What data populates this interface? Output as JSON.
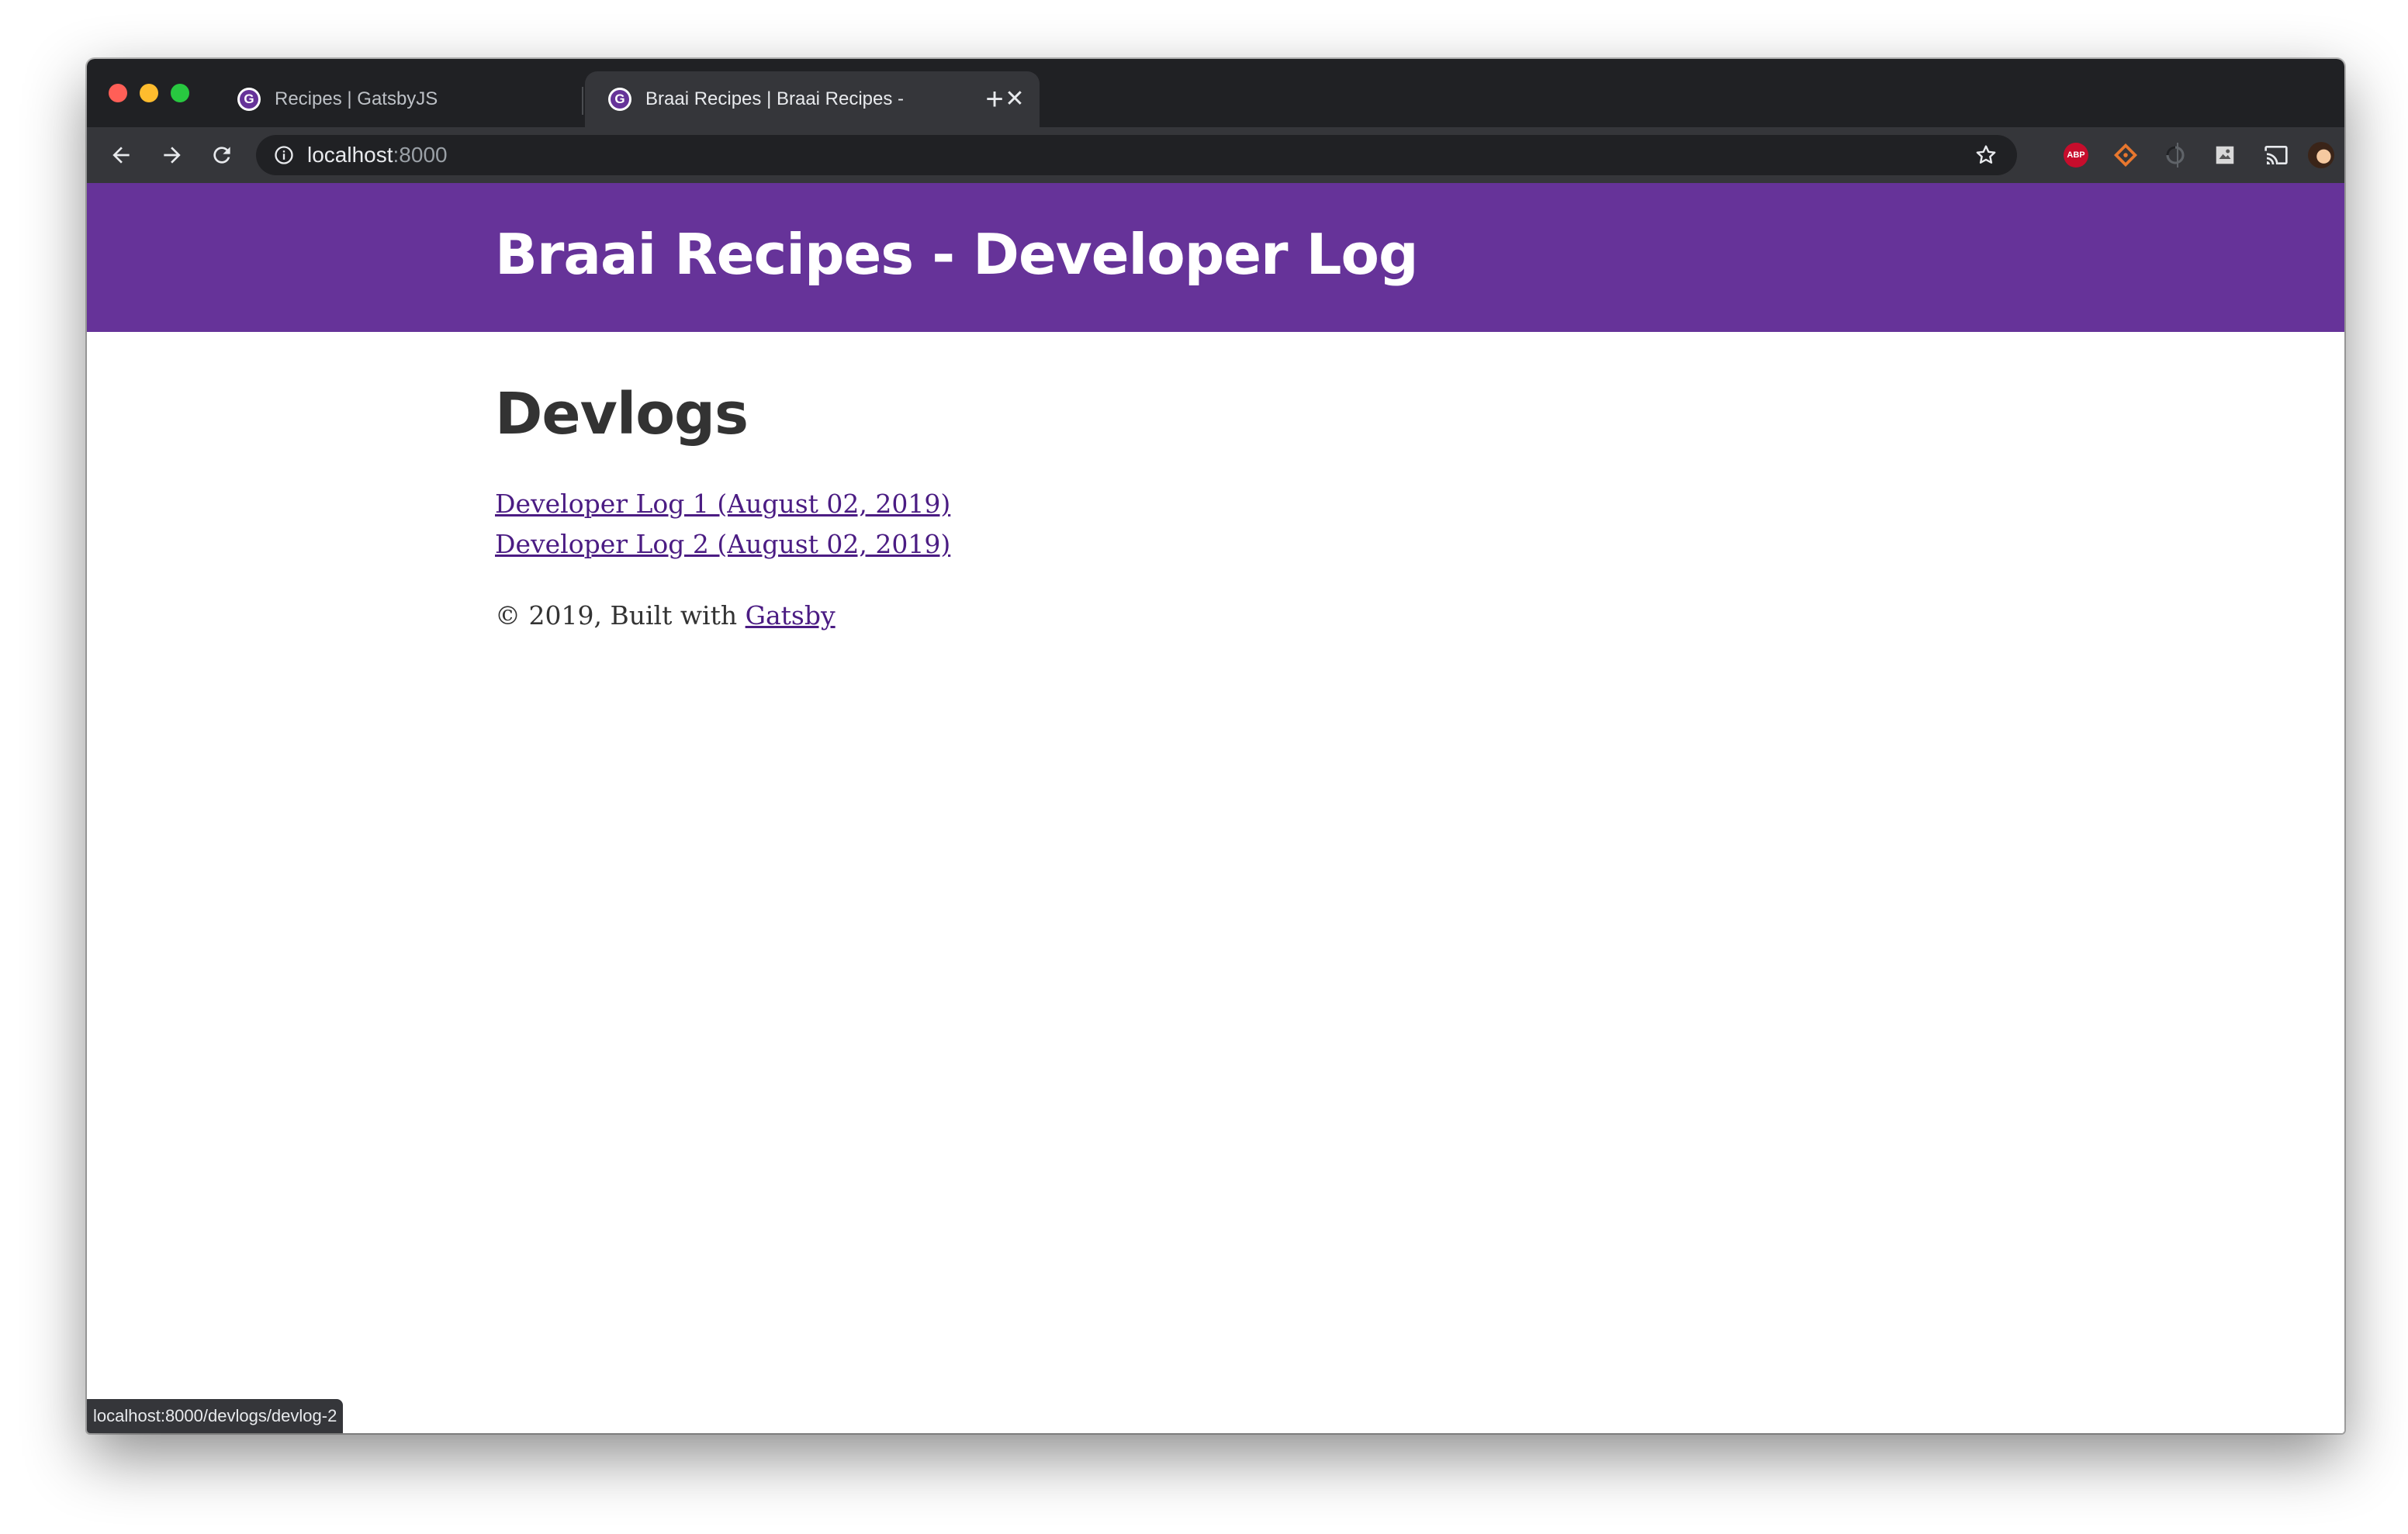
{
  "browser": {
    "tabs": [
      {
        "title": "Recipes | GatsbyJS",
        "active": false
      },
      {
        "title": "Braai Recipes | Braai Recipes -",
        "active": true
      }
    ],
    "favicon_letter": "G",
    "new_tab_symbol": "+",
    "close_symbol": "✕",
    "url_host": "localhost",
    "url_port": ":8000",
    "extensions": [
      "adblock-plus-icon",
      "git-diamond-icon",
      "loading-circle-icon",
      "puzzle-image-icon"
    ],
    "abp_label": "ABP",
    "status_url": "localhost:8000/devlogs/devlog-2"
  },
  "site": {
    "title": "Braai Recipes - Developer Log",
    "header_color": "#663399",
    "link_color": "#4b1c83"
  },
  "main": {
    "heading": "Devlogs",
    "devlogs": [
      {
        "label": "Developer Log 1 (August 02, 2019)"
      },
      {
        "label": "Developer Log 2 (August 02, 2019)"
      }
    ],
    "footer_prefix": "© 2019, Built with ",
    "footer_link": "Gatsby"
  }
}
